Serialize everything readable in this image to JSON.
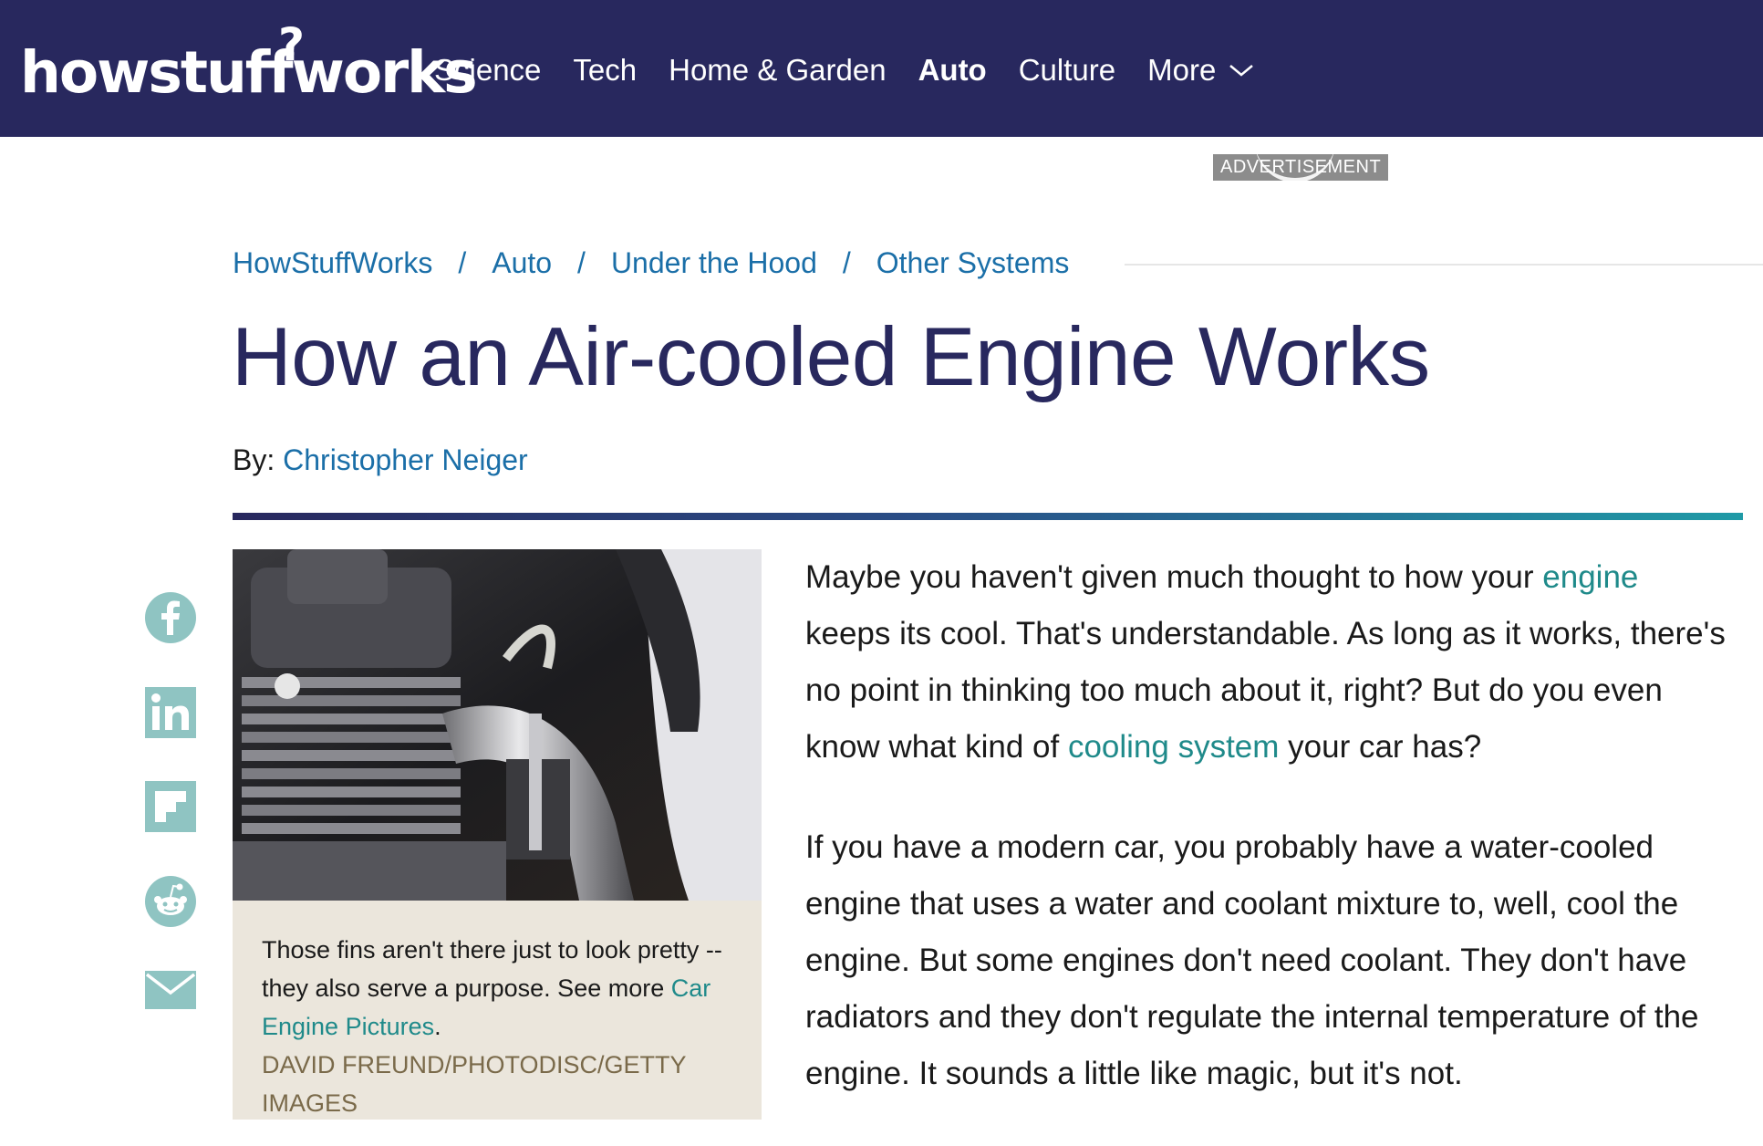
{
  "header": {
    "logo_text": "howstuffworks",
    "logo_q": "?",
    "nav": [
      {
        "label": "Science"
      },
      {
        "label": "Tech"
      },
      {
        "label": "Home & Garden"
      },
      {
        "label": "Auto",
        "active": true
      },
      {
        "label": "Culture"
      },
      {
        "label": "More"
      }
    ]
  },
  "ad": {
    "label": "ADVERTISEMENT"
  },
  "breadcrumb": {
    "items": [
      "HowStuffWorks",
      "Auto",
      "Under the Hood",
      "Other Systems"
    ],
    "separator": "/"
  },
  "article": {
    "title": "How an Air-cooled Engine Works",
    "byline_prefix": "By:",
    "author": "Christopher Neiger",
    "figure": {
      "caption_text": "Those fins aren't there just to look pretty -- they also serve a purpose. See more ",
      "caption_link": "Car Engine Pictures",
      "caption_end": ".",
      "credit": "DAVID FREUND/PHOTODISC/GETTY IMAGES"
    },
    "p1": {
      "a": "Maybe you haven't given much thought to how your ",
      "link1": "engine",
      "b": " keeps its cool. That's understandable. As long as it works, there's no point in thinking too much about it, right? But do you even know what kind of ",
      "link2": "cooling system",
      "c": " your car has?"
    },
    "p2": "If you have a modern car, you probably have a water-cooled engine that uses a water and coolant mixture to, well, cool the engine. But some engines don't need coolant. They don't have radiators and they don't regulate the internal temperature of the engine. It sounds a little like magic, but it's not."
  },
  "share": [
    "facebook-icon",
    "linkedin-icon",
    "flipboard-icon",
    "reddit-icon",
    "email-icon"
  ],
  "colors": {
    "header_bg": "#28285e",
    "link": "#1b6fa8",
    "body_link": "#1f8a8a",
    "share_icon": "#8fc4c2",
    "caption_bg": "#ebe6dc"
  }
}
